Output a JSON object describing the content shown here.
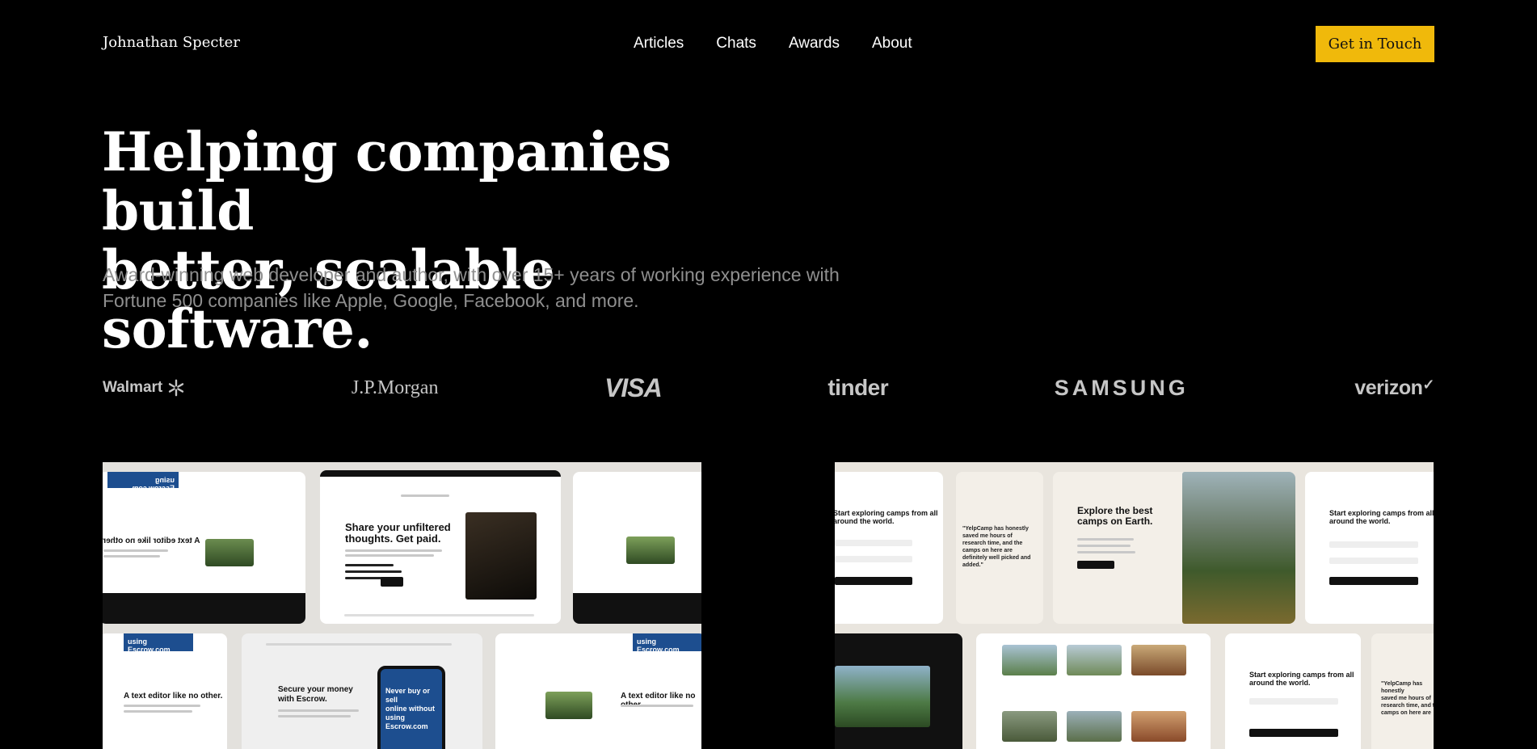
{
  "nav": {
    "brand": "Johnathan Specter",
    "links": [
      "Articles",
      "Chats",
      "Awards",
      "About"
    ],
    "cta": "Get in Touch"
  },
  "hero": {
    "title_line1": "Helping companies build",
    "title_line2": "better, scalable software.",
    "subtitle_line1": "Award-winning web developer and author, with over 15+ years of working experience with",
    "subtitle_line2": "Fortune 500 companies like Apple, Google, Facebook, and more."
  },
  "logos": [
    "Walmart",
    "J.P.Morgan",
    "VISA",
    "tinder",
    "SAMSUNG",
    "verizon"
  ],
  "showcase_left": {
    "share_title_line1": "Share your unfiltered",
    "share_title_line2": "thoughts. Get paid.",
    "escrow_title_line1": "Secure your money",
    "escrow_title_line2": "with Escrow.",
    "phone_text_line1": "Never buy or sell",
    "phone_text_line2": "online without",
    "phone_text_line3": "using Escrow.com",
    "editor_title": "A text editor like no other.",
    "editor_title_mirrored": "A text editor like no other.",
    "using_escrow": "using Escrow.com"
  },
  "showcase_right": {
    "explore_line1": "Explore the best",
    "explore_line2": "camps on Earth.",
    "start_line1": "Start exploring camps from all",
    "start_line2": "around the world.",
    "quote_line1": "\"YelpCamp has honestly",
    "quote_line2": "saved me hours of",
    "quote_line3": "research time, and the",
    "quote_line4": "camps on here are",
    "quote_line5": "definitely well picked and",
    "quote_line6": "added.\""
  },
  "colors": {
    "background": "#000000",
    "accent": "#f0b90b",
    "muted_text": "#8f8f8f",
    "logo_gray": "#c6c6c6"
  }
}
